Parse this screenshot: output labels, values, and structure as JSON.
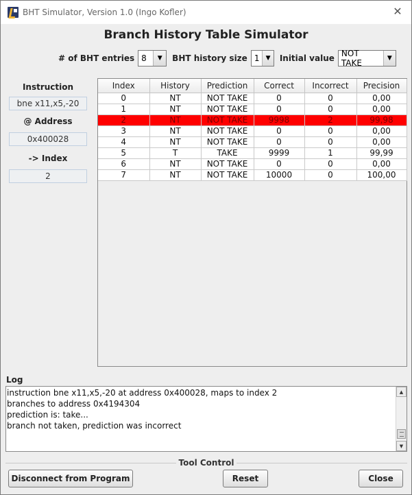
{
  "window": {
    "title": "BHT Simulator, Version 1.0 (Ingo Kofler)"
  },
  "heading": "Branch History Table Simulator",
  "config": {
    "entries_label": "# of BHT entries",
    "entries_value": "8",
    "history_label": "BHT history size",
    "history_value": "1",
    "initial_label": "Initial value",
    "initial_value": "NOT TAKE"
  },
  "left": {
    "instruction_label": "Instruction",
    "instruction_value": "bne x11,x5,-20",
    "address_label": "@ Address",
    "address_value": "0x400028",
    "index_label": "-> Index",
    "index_value": "2"
  },
  "table": {
    "columns": [
      "Index",
      "History",
      "Prediction",
      "Correct",
      "Incorrect",
      "Precision"
    ],
    "selected_row": 2,
    "rows": [
      [
        "0",
        "NT",
        "NOT TAKE",
        "0",
        "0",
        "0,00"
      ],
      [
        "1",
        "NT",
        "NOT TAKE",
        "0",
        "0",
        "0,00"
      ],
      [
        "2",
        "NT",
        "NOT TAKE",
        "9998",
        "2",
        "99,98"
      ],
      [
        "3",
        "NT",
        "NOT TAKE",
        "0",
        "0",
        "0,00"
      ],
      [
        "4",
        "NT",
        "NOT TAKE",
        "0",
        "0",
        "0,00"
      ],
      [
        "5",
        "T",
        "TAKE",
        "9999",
        "1",
        "99,99"
      ],
      [
        "6",
        "NT",
        "NOT TAKE",
        "0",
        "0",
        "0,00"
      ],
      [
        "7",
        "NT",
        "NOT TAKE",
        "10000",
        "0",
        "100,00"
      ]
    ]
  },
  "log": {
    "label": "Log",
    "lines": [
      "instruction bne x11,x5,-20 at address 0x400028, maps to index 2",
      "branches to address 0x4194304",
      "prediction is: take...",
      "branch not taken, prediction was incorrect"
    ]
  },
  "tool": {
    "label": "Tool Control",
    "disconnect": "Disconnect from Program",
    "reset": "Reset",
    "close": "Close"
  },
  "colors": {
    "selected_row": "#ff0000",
    "selected_text": "#7a0000"
  },
  "icons": {
    "app": "bht-app-icon",
    "close": "close-icon",
    "dropdown": "chevron-down-icon",
    "scroll_up": "scroll-up-icon",
    "scroll_down": "scroll-down-icon"
  }
}
